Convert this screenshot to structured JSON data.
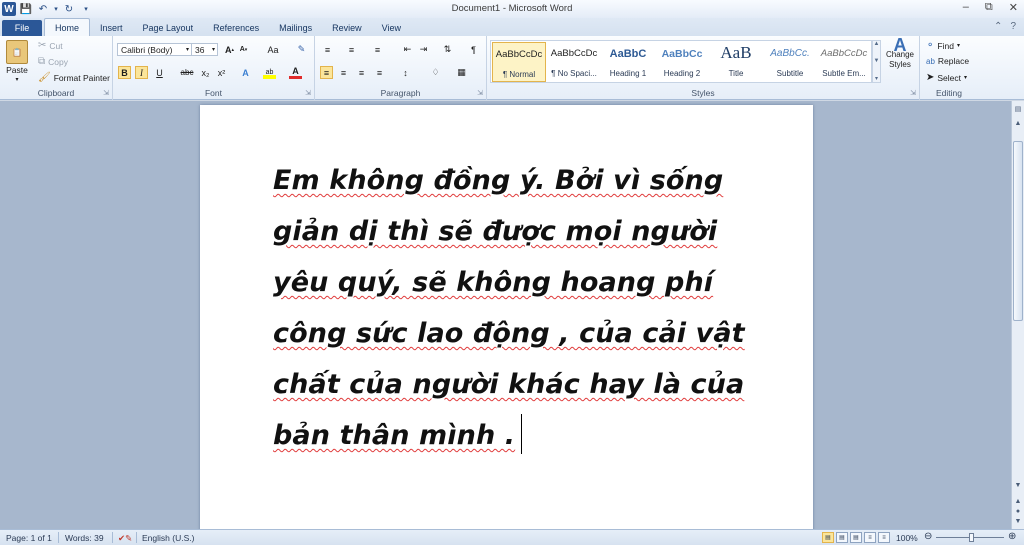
{
  "window": {
    "title": "Document1 - Microsoft Word",
    "qat_icons": [
      "word-logo",
      "save-icon",
      "undo-icon",
      "redo-icon",
      "customize-icon"
    ],
    "controls": [
      "minimize",
      "restore",
      "close"
    ]
  },
  "tabs": [
    "File",
    "Home",
    "Insert",
    "Page Layout",
    "References",
    "Mailings",
    "Review",
    "View"
  ],
  "active_tab": "Home",
  "ribbon": {
    "clipboard": {
      "label": "Clipboard",
      "paste": "Paste",
      "cut": "Cut",
      "copy": "Copy",
      "format_painter": "Format Painter"
    },
    "font": {
      "label": "Font",
      "font_name": "Calibri (Body)",
      "font_size": "36",
      "bold": "B",
      "italic": "I",
      "underline": "U",
      "strikethrough": "abc",
      "subscript": "x₂",
      "superscript": "x²",
      "change_case": "Aa",
      "grow": "A",
      "shrink": "A"
    },
    "paragraph": {
      "label": "Paragraph"
    },
    "styles": {
      "label": "Styles",
      "items": [
        {
          "sample": "AaBbCcDc",
          "name": "¶ Normal"
        },
        {
          "sample": "AaBbCcDc",
          "name": "¶ No Spaci..."
        },
        {
          "sample": "AaBbC",
          "name": "Heading 1"
        },
        {
          "sample": "AaBbCc",
          "name": "Heading 2"
        },
        {
          "sample": "AaB",
          "name": "Title"
        },
        {
          "sample": "AaBbCc.",
          "name": "Subtitle"
        },
        {
          "sample": "AaBbCcDc",
          "name": "Subtle Em..."
        }
      ],
      "change_styles": "Change Styles"
    },
    "editing": {
      "label": "Editing",
      "find": "Find",
      "replace": "Replace",
      "select": "Select"
    }
  },
  "document": {
    "lines": [
      "Em không đồng ý. Bởi vì sống",
      "giản dị thì sẽ được mọi người",
      "yêu quý, sẽ không hoang phí",
      "công sức lao động , của cải vật",
      "chất của người khác hay là của",
      "bản thân mình ."
    ]
  },
  "status": {
    "page": "Page: 1 of 1",
    "words": "Words: 39",
    "language": "English (U.S.)",
    "zoom": "100%",
    "zoom_level": 1.0
  },
  "colors": {
    "file_tab": "#2b5797",
    "highlight": "#fbe59a",
    "spellcheck": "#e03b3b"
  }
}
